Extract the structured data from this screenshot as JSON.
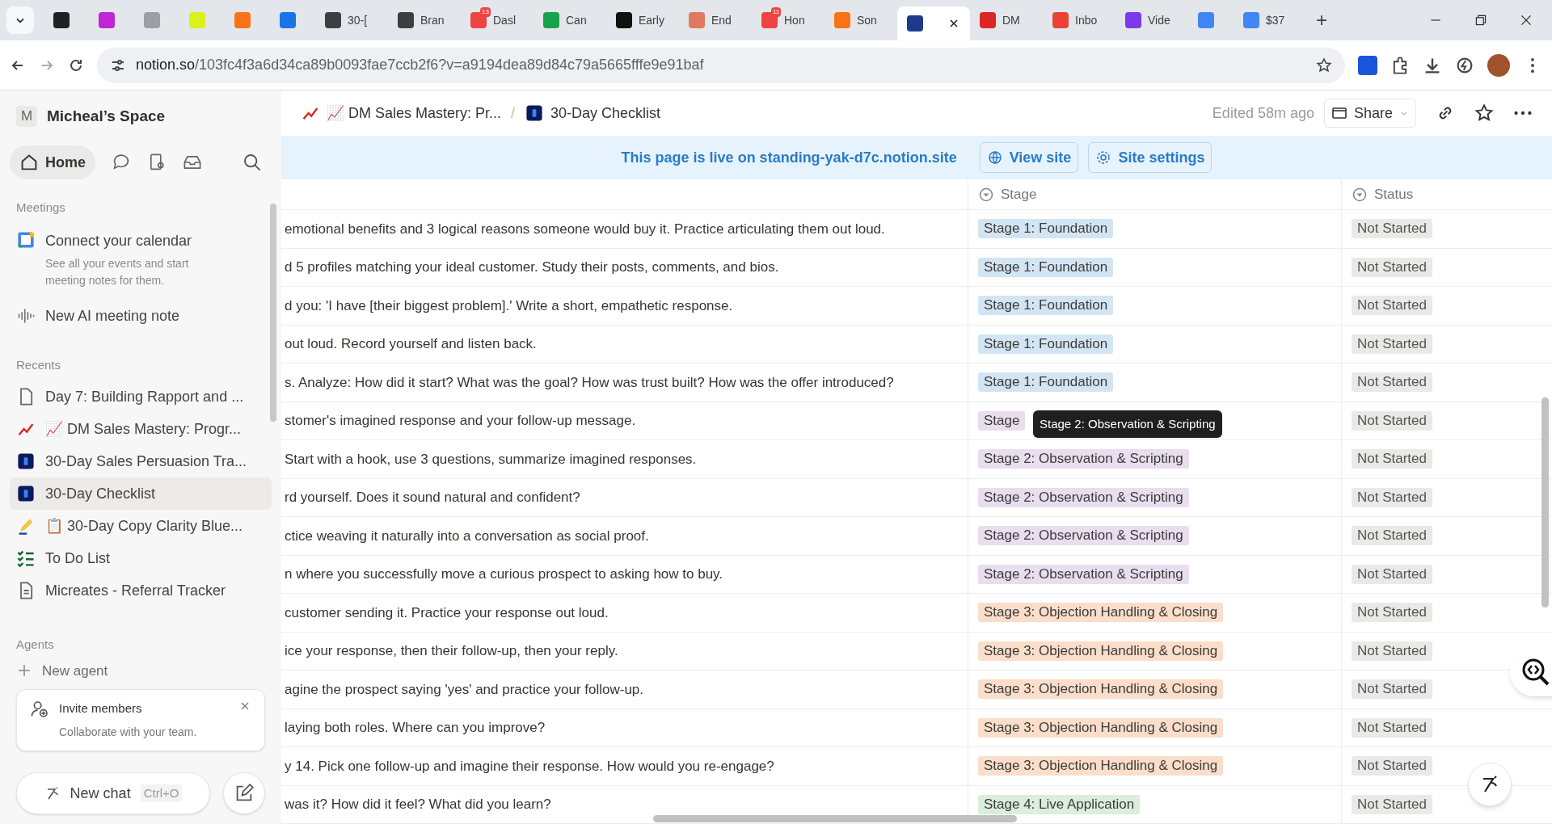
{
  "browser": {
    "tabs": [
      {
        "color": "#202124",
        "selected": false
      },
      {
        "color": "#c026d3",
        "selected": false
      },
      {
        "color": "#9aa0a6",
        "selected": false
      },
      {
        "color": "#d9f21b",
        "selected": false
      },
      {
        "color": "#f97316",
        "selected": false
      },
      {
        "color": "#1a73e8",
        "selected": false
      },
      {
        "color": "#3c4043",
        "label": "30-[",
        "selected": false
      },
      {
        "color": "#3c4043",
        "label": "Bran",
        "selected": false
      },
      {
        "color": "#ef4444",
        "label": "Dasl",
        "badge": "13",
        "selected": false
      },
      {
        "color": "#16a34a",
        "label": "Can",
        "selected": false
      },
      {
        "color": "#111111",
        "label": "Early",
        "selected": false
      },
      {
        "color": "#e07a5f",
        "label": "End",
        "selected": false
      },
      {
        "color": "#ef4444",
        "label": "Hon",
        "badge": "11",
        "selected": false
      },
      {
        "color": "#f97316",
        "label": "Son",
        "selected": false
      },
      {
        "color": "#1e3a8a",
        "selected": true
      },
      {
        "color": "#dc2626",
        "label": "DM",
        "selected": false
      },
      {
        "color": "#ea4335",
        "label": "Inbo",
        "selected": false
      },
      {
        "color": "#7c3aed",
        "label": "Vide",
        "selected": false
      },
      {
        "color": "#4285f4",
        "selected": false
      },
      {
        "color": "#4285f4",
        "label": "$37",
        "selected": false
      }
    ],
    "new_tab": "+",
    "url": {
      "host": "notion.so",
      "path": "/103fc4f3a6d34ca89b0093fae7ccb2f6?v=a9194dea89d84c79a5665fffe9e91baf"
    }
  },
  "sidebar": {
    "workspace": {
      "initial": "M",
      "name": "Micheal’s Space"
    },
    "home": {
      "label": "Home",
      "selected": true
    },
    "meetings": {
      "heading": "Meetings",
      "calendar_title": "Connect your calendar",
      "calendar_text": "See all your events and start meeting notes for them.",
      "new_note": "New AI meeting note"
    },
    "recents": {
      "heading": "Recents",
      "items": [
        {
          "kind": "page",
          "label": "Day 7: Building Rapport and ...",
          "selected": false
        },
        {
          "kind": "chart",
          "label": "📈 DM Sales Mastery: Progr...",
          "selected": false
        },
        {
          "kind": "app",
          "label": "30-Day Sales Persuasion Tra...",
          "selected": false
        },
        {
          "kind": "app",
          "label": "30-Day Checklist",
          "selected": true
        },
        {
          "kind": "pen",
          "label": "📋 30-Day Copy Clarity Blue...",
          "selected": false
        },
        {
          "kind": "todo",
          "label": "To Do List",
          "selected": false
        },
        {
          "kind": "doc",
          "label": "Micreates - Referral Tracker",
          "selected": false
        }
      ]
    },
    "agents": {
      "heading": "Agents",
      "new_agent": "New agent"
    },
    "invite": {
      "title": "Invite members",
      "text": "Collaborate with your team."
    },
    "new_chat": {
      "label": "New chat",
      "shortcut": "Ctrl+O"
    }
  },
  "header": {
    "breadcrumbs": [
      {
        "kind": "chart",
        "label": "📈 DM Sales Mastery: Pr..."
      },
      {
        "kind": "app",
        "label": "30-Day Checklist"
      }
    ],
    "separator": "/",
    "edited": "Edited 58m ago",
    "share": "Share"
  },
  "banner": {
    "text": "This page is live on standing-yak-d7c.notion.site",
    "view_site": "View site",
    "site_settings": "Site settings"
  },
  "table": {
    "columns": [
      "Stage",
      "Status"
    ],
    "rows": [
      {
        "task": "emotional benefits and 3 logical reasons someone would buy it. Practice articulating them out loud.",
        "stage": "Stage 1: Foundation",
        "color": "#d3e5f3",
        "status": "Not Started"
      },
      {
        "task": "d 5 profiles matching your ideal customer. Study their posts, comments, and bios.",
        "stage": "Stage 1: Foundation",
        "color": "#d3e5f3",
        "status": "Not Started"
      },
      {
        "task": "d you: 'I have [their biggest problem].' Write a short, empathetic response.",
        "stage": "Stage 1: Foundation",
        "color": "#d3e5f3",
        "status": "Not Started"
      },
      {
        "task": "out loud. Record yourself and listen back.",
        "stage": "Stage 1: Foundation",
        "color": "#d3e5f3",
        "status": "Not Started"
      },
      {
        "task": "s. Analyze: How did it start? What was the goal? How was trust built? How was the offer introduced?",
        "stage": "Stage 1: Foundation",
        "color": "#d3e5f3",
        "status": "Not Started"
      },
      {
        "task": "stomer's imagined response and your follow-up message.",
        "stage": "Stage",
        "color": "#e8deee",
        "status": "Not Started",
        "tooltip": "Stage 2: Observation & Scripting"
      },
      {
        "task": "Start with a hook, use 3 questions, summarize imagined responses.",
        "stage": "Stage 2: Observation & Scripting",
        "color": "#e8deee",
        "status": "Not Started"
      },
      {
        "task": "rd yourself. Does it sound natural and confident?",
        "stage": "Stage 2: Observation & Scripting",
        "color": "#e8deee",
        "status": "Not Started"
      },
      {
        "task": "ctice weaving it naturally into a conversation as social proof.",
        "stage": "Stage 2: Observation & Scripting",
        "color": "#e8deee",
        "status": "Not Started"
      },
      {
        "task": "n where you successfully move a curious prospect to asking how to buy.",
        "stage": "Stage 2: Observation & Scripting",
        "color": "#e8deee",
        "status": "Not Started"
      },
      {
        "task": "customer sending it. Practice your response out loud.",
        "stage": "Stage 3: Objection Handling & Closing",
        "color": "#fadec9",
        "status": "Not Started"
      },
      {
        "task": "ice your response, then their follow-up, then your reply.",
        "stage": "Stage 3: Objection Handling & Closing",
        "color": "#fadec9",
        "status": "Not Started"
      },
      {
        "task": "agine the prospect saying 'yes' and practice your follow-up.",
        "stage": "Stage 3: Objection Handling & Closing",
        "color": "#fadec9",
        "status": "Not Started"
      },
      {
        "task": "laying both roles. Where can you improve?",
        "stage": "Stage 3: Objection Handling & Closing",
        "color": "#fadec9",
        "status": "Not Started"
      },
      {
        "task": "y 14. Pick one follow-up and imagine their response. How would you re-engage?",
        "stage": "Stage 3: Objection Handling & Closing",
        "color": "#fadec9",
        "status": "Not Started"
      },
      {
        "task": "was it? How did it feel? What did you learn?",
        "stage": "Stage 4: Live Application",
        "color": "#dbeddb",
        "status": "Not Started"
      }
    ]
  }
}
